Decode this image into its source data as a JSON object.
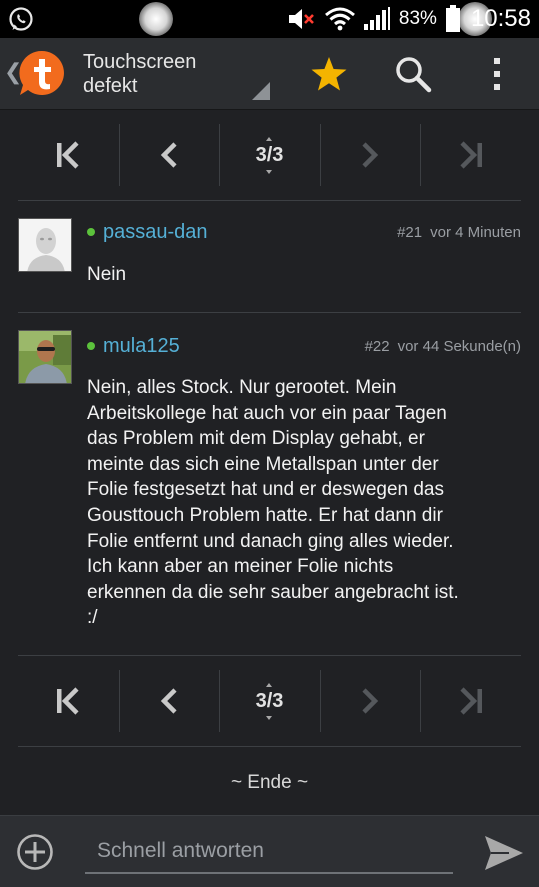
{
  "status_bar": {
    "battery_percent": "83%",
    "time": "10:58",
    "icons": [
      "whatsapp-icon",
      "mute-icon",
      "wifi-icon",
      "signal-icon",
      "battery-icon"
    ]
  },
  "action_bar": {
    "title_line1": "Touchscreen",
    "title_line2": "defekt",
    "icons": [
      "back-chevron-icon",
      "tapatalk-logo",
      "star-icon",
      "search-icon",
      "overflow-menu-icon"
    ],
    "star_color": "#f4b400"
  },
  "pager": {
    "page_label": "3/3",
    "icons": [
      "first-page-icon",
      "previous-page-icon",
      "next-page-icon",
      "last-page-icon"
    ]
  },
  "posts": [
    {
      "username": "passau-dan",
      "number": "#21",
      "time": "vor 4 Minuten",
      "body": "Nein",
      "online": true
    },
    {
      "username": "mula125",
      "number": "#22",
      "time": "vor 44 Sekunde(n)",
      "body_lines": [
        "Nein, alles Stock. Nur gerootet. Mein",
        "Arbeitskollege hat auch vor ein paar Tagen",
        "das Problem mit dem Display gehabt, er",
        "meinte das sich eine Metallspan unter der",
        "Folie festgesetzt hat und er deswegen das",
        "Gousttouch Problem hatte. Er hat dann dir",
        "Folie entfernt und danach ging alles wieder.",
        "Ich kann aber an meiner Folie nichts",
        "erkennen da die sehr sauber angebracht ist.",
        ":/"
      ],
      "online": true
    }
  ],
  "end_label": "~ Ende ~",
  "reply": {
    "placeholder": "Schnell antworten",
    "value": ""
  },
  "colors": {
    "accent_username": "#55b0d6",
    "online_dot": "#5cc23c",
    "logo_orange": "#f26b1d"
  }
}
